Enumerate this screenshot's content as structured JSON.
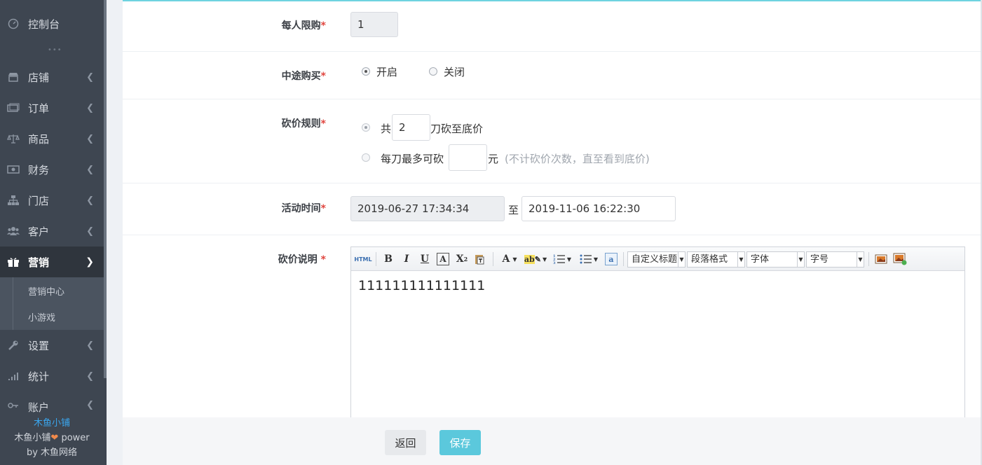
{
  "sidebar": {
    "items": [
      {
        "label": "控制台",
        "icon": "dashboard-icon"
      },
      {
        "label": "店铺",
        "icon": "store-icon"
      },
      {
        "label": "订单",
        "icon": "order-icon"
      },
      {
        "label": "商品",
        "icon": "scale-icon"
      },
      {
        "label": "财务",
        "icon": "money-icon"
      },
      {
        "label": "门店",
        "icon": "sitemap-icon"
      },
      {
        "label": "客户",
        "icon": "users-icon"
      },
      {
        "label": "营销",
        "icon": "gift-icon"
      },
      {
        "label": "设置",
        "icon": "wrench-icon"
      },
      {
        "label": "统计",
        "icon": "signal-icon"
      },
      {
        "label": "账户",
        "icon": "key-icon"
      }
    ],
    "submenu": [
      "营销中心",
      "小游戏"
    ],
    "brand": {
      "name": "木鱼小铺",
      "power_prefix": "木鱼小铺",
      "power_suffix": "power",
      "by": "by 木鱼网络"
    }
  },
  "form": {
    "limit": {
      "label": "每人限购",
      "value": "1"
    },
    "midway": {
      "label": "中途购买",
      "options": [
        "开启",
        "关闭"
      ],
      "selected": "开启"
    },
    "rule": {
      "label": "砍价规则",
      "opt1_prefix": "共",
      "opt1_value": "2",
      "opt1_suffix": "刀砍至底价",
      "opt2_prefix": "每刀最多可砍",
      "opt2_value": "",
      "opt2_suffix": "元",
      "opt2_hint": "(不计砍价次数，直至看到底价)",
      "selected": 1
    },
    "time": {
      "label": "活动时间",
      "start": "2019-06-27 17:34:34",
      "sep": "至",
      "end": "2019-11-06 16:22:30"
    },
    "desc": {
      "label": "砍价说明",
      "toolbar_selects": [
        "自定义标题",
        "段落格式",
        "字体",
        "字号"
      ],
      "content": "111111111111111"
    }
  },
  "footer": {
    "back": "返回",
    "save": "保存"
  },
  "colors": {
    "accent": "#5bc8dc",
    "required": "#e0463f",
    "sidebar_bg": "#3e4651",
    "brand": "#3aa6ee"
  }
}
